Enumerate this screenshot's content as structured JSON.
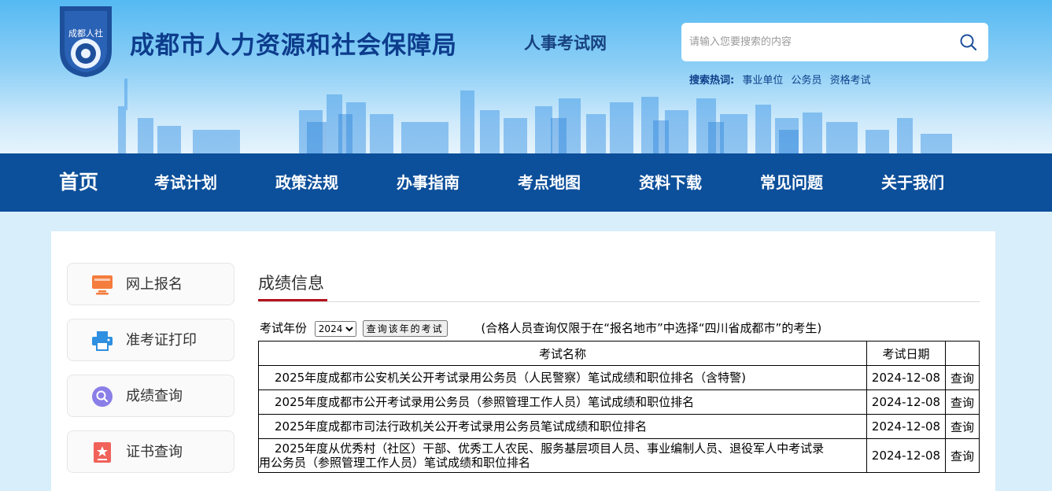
{
  "header": {
    "logo_text": "成都人社",
    "title": "成都市人力资源和社会保障局",
    "subtitle": "人事考试网",
    "search_placeholder": "请输入您要搜索的内容",
    "hot_label": "搜索热词:",
    "hot_words": [
      "事业单位",
      "公务员",
      "资格考试"
    ]
  },
  "nav": {
    "items": [
      "首页",
      "考试计划",
      "政策法规",
      "办事指南",
      "考点地图",
      "资料下载",
      "常见问题",
      "关于我们"
    ]
  },
  "sidebar": {
    "items": [
      {
        "label": "网上报名",
        "icon": "monitor-icon",
        "color": "#f47c3c"
      },
      {
        "label": "准考证打印",
        "icon": "printer-icon",
        "color": "#2f8fe0"
      },
      {
        "label": "成绩查询",
        "icon": "search-icon",
        "color": "#8a7ee8"
      },
      {
        "label": "证书查询",
        "icon": "certificate-icon",
        "color": "#f0625a"
      }
    ]
  },
  "main": {
    "title": "成绩信息",
    "year_label": "考试年份",
    "year_value": "2024",
    "query_button": "查询该年的考试",
    "note": "(合格人员查询仅限于在“报名地市”中选择“四川省成都市”的考生)",
    "table": {
      "headers": [
        "考试名称",
        "考试日期",
        ""
      ],
      "rows": [
        {
          "name": "2025年度成都市公安机关公开考试录用公务员（人民警察）笔试成绩和职位排名（含特警)",
          "date": "2024-12-08",
          "action": "查询"
        },
        {
          "name": "2025年度成都市公开考试录用公务员（参照管理工作人员）笔试成绩和职位排名",
          "date": "2024-12-08",
          "action": "查询"
        },
        {
          "name": "2025年度成都市司法行政机关公开考试录用公务员笔试成绩和职位排名",
          "date": "2024-12-08",
          "action": "查询"
        },
        {
          "name_line1": "2025年度从优秀村（社区）干部、优秀工人农民、服务基层项目人员、事业编制人员、退役军人中考试录",
          "name_line2": "用公务员（参照管理工作人员）笔试成绩和职位排名",
          "date": "2024-12-08",
          "action": "查询"
        }
      ]
    }
  },
  "colors": {
    "nav_bg": "#0c4f9a",
    "title_blue": "#0d3c8c",
    "accent_red": "#b4121c"
  }
}
